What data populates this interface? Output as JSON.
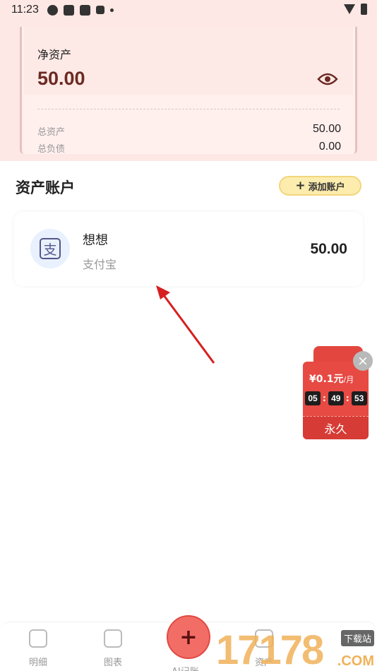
{
  "status_bar": {
    "time": "11:23"
  },
  "summary": {
    "net_label": "净资产",
    "net_value": "50.00",
    "total_assets_label": "总资产",
    "total_assets_value": "50.00",
    "total_liabilities_label": "总负债",
    "total_liabilities_value": "0.00"
  },
  "section": {
    "title": "资产账户",
    "add_button_label": "添加账户"
  },
  "accounts": [
    {
      "name": "想想",
      "type": "支付宝",
      "amount": "50.00",
      "icon": "alipay-icon"
    }
  ],
  "promo": {
    "price": "¥0.1元",
    "unit": "/月",
    "countdown": [
      "05",
      "49",
      "53"
    ],
    "button_label": "永久"
  },
  "bottom_nav": {
    "items": [
      {
        "label": "明细",
        "icon": "detail-icon"
      },
      {
        "label": "图表",
        "icon": "chart-icon"
      },
      {
        "label": "AI记账",
        "icon": "add-icon"
      },
      {
        "label": "资产",
        "icon": "asset-icon"
      }
    ]
  },
  "watermark": {
    "number": "17178",
    "tag": "下载站",
    "suffix": ".COM"
  },
  "colors": {
    "header_bg": "#fde8e5",
    "net_value": "#6b2a22",
    "add_button": "#fcecae",
    "fab": "#f26d66",
    "promo": "#e64a43"
  }
}
